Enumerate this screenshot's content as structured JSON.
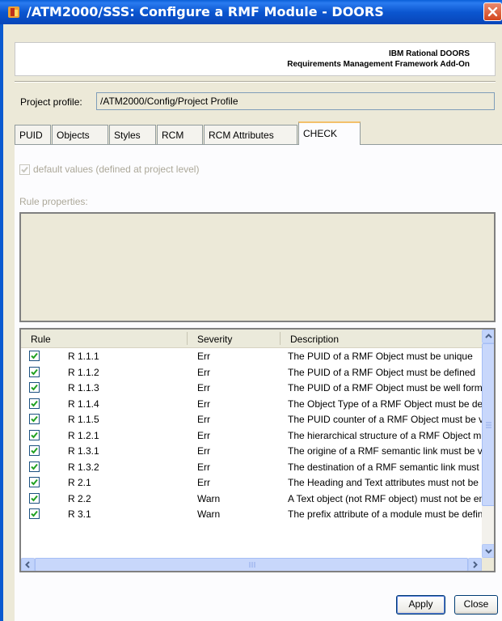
{
  "window": {
    "title": "/ATM2000/SSS: Configure a RMF Module - DOORS",
    "app_icon": "doors-app-icon",
    "close_icon": "close-icon"
  },
  "banner": {
    "line1": "IBM Rational DOORS",
    "line2": "Requirements Management Framework Add-On"
  },
  "profile": {
    "label": "Project profile:",
    "value": "/ATM2000/Config/Project Profile"
  },
  "tabs": [
    {
      "label": "PUID"
    },
    {
      "label": "Objects"
    },
    {
      "label": "Styles"
    },
    {
      "label": "RCM"
    },
    {
      "label": "RCM Attributes"
    },
    {
      "label": "CHECK",
      "active": true
    }
  ],
  "check_tab": {
    "default_values_label": "default values (defined at project level)",
    "default_values_checked": true,
    "rule_properties_label": "Rule properties:",
    "grid": {
      "columns": [
        "Rule",
        "Severity",
        "Description"
      ],
      "rows": [
        {
          "checked": true,
          "rule": "R 1.1.1",
          "severity": "Err",
          "description": "The PUID of a RMF Object must be unique"
        },
        {
          "checked": true,
          "rule": "R 1.1.2",
          "severity": "Err",
          "description": "The PUID of a RMF Object must be defined"
        },
        {
          "checked": true,
          "rule": "R 1.1.3",
          "severity": "Err",
          "description": "The PUID of a RMF Object must be well formed"
        },
        {
          "checked": true,
          "rule": "R 1.1.4",
          "severity": "Err",
          "description": "The Object Type of a RMF Object must be defined"
        },
        {
          "checked": true,
          "rule": "R 1.1.5",
          "severity": "Err",
          "description": "The PUID counter of a RMF Object must be valid"
        },
        {
          "checked": true,
          "rule": "R 1.2.1",
          "severity": "Err",
          "description": "The hierarchical structure of a RMF Object must be valid"
        },
        {
          "checked": true,
          "rule": "R 1.3.1",
          "severity": "Err",
          "description": "The origine of a RMF semantic link must be valid"
        },
        {
          "checked": true,
          "rule": "R 1.3.2",
          "severity": "Err",
          "description": "The destination of a RMF semantic link must be valid"
        },
        {
          "checked": true,
          "rule": "R 2.1",
          "severity": "Err",
          "description": "The Heading and Text attributes must not be both filled"
        },
        {
          "checked": true,
          "rule": "R 2.2",
          "severity": "Warn",
          "description": "A Text object (not RMF object) must not be empty"
        },
        {
          "checked": true,
          "rule": "R 3.1",
          "severity": "Warn",
          "description": "The prefix attribute of a module must be defined"
        }
      ]
    }
  },
  "buttons": {
    "apply": "Apply",
    "close": "Close"
  }
}
